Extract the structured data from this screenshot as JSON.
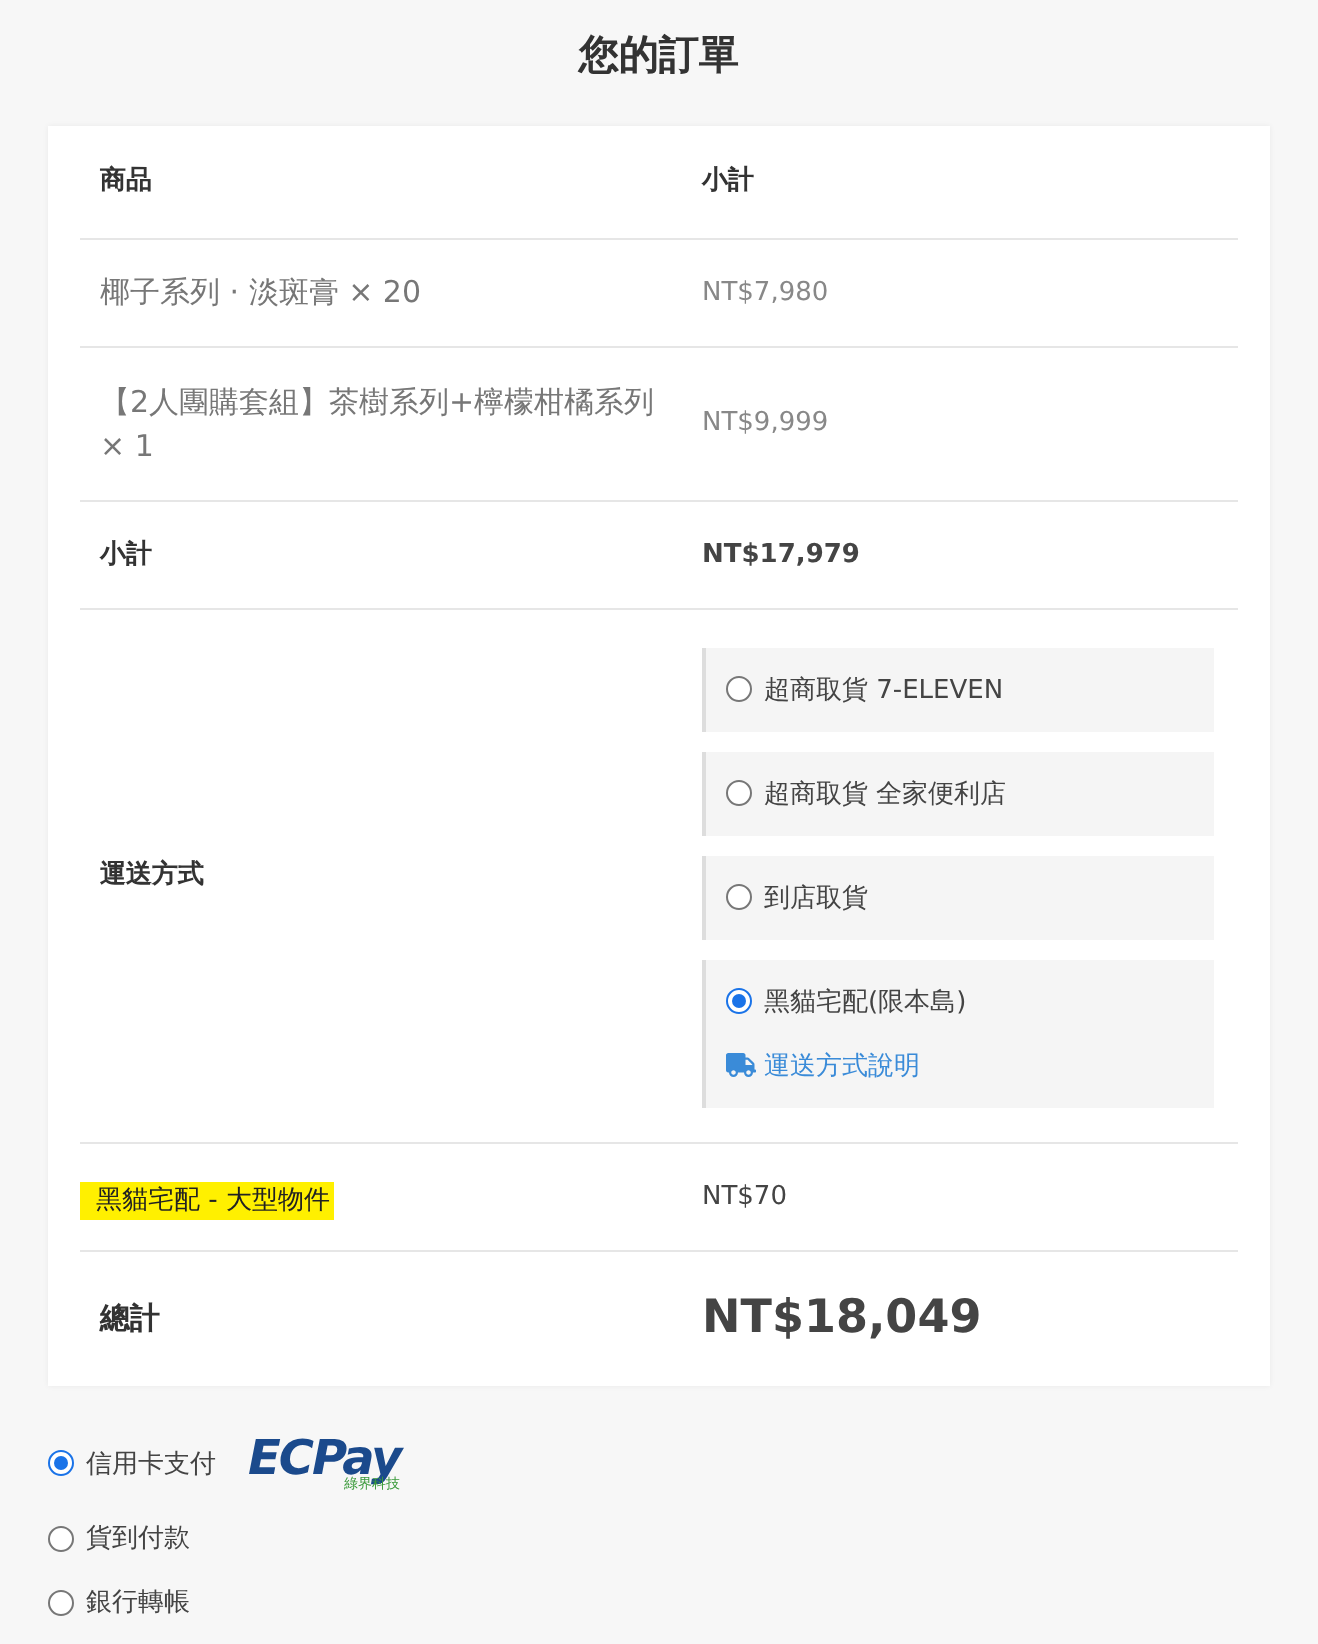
{
  "title": "您的訂單",
  "table": {
    "columns": [
      "商品",
      "小計"
    ],
    "items": [
      {
        "name": "椰子系列 · 淡斑膏",
        "qty": "× 20",
        "price": "NT$7,980"
      },
      {
        "name": "【2人團購套組】茶樹系列+檸檬柑橘系列",
        "qty": "× 1",
        "price": "NT$9,999"
      }
    ],
    "subtotal": {
      "label": "小計",
      "value": "NT$17,979"
    },
    "shipping": {
      "label": "運送方式",
      "options": [
        {
          "label": "超商取貨 7-ELEVEN",
          "selected": false
        },
        {
          "label": "超商取貨 全家便利店",
          "selected": false
        },
        {
          "label": "到店取貨",
          "selected": false
        },
        {
          "label": "黑貓宅配(限本島)",
          "selected": true,
          "link": "運送方式說明"
        }
      ]
    },
    "fee": {
      "label": "黑貓宅配 - 大型物件",
      "highlighted": true,
      "value": "NT$70"
    },
    "total": {
      "label": "總計",
      "value": "NT$18,049"
    }
  },
  "payment": {
    "methods": [
      {
        "label": "信用卡支付",
        "selected": true,
        "logo": {
          "main": "ECPay",
          "sub": "綠界科技"
        }
      },
      {
        "label": "貨到付款",
        "selected": false
      },
      {
        "label": "銀行轉帳",
        "selected": false
      }
    ]
  }
}
